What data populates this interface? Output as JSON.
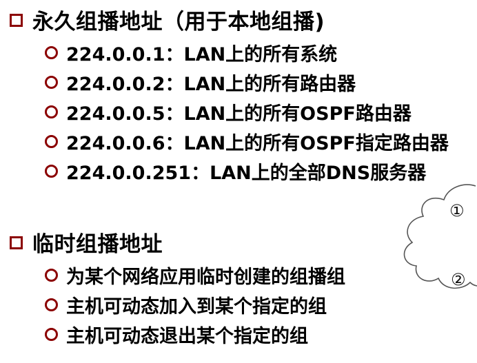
{
  "section1": {
    "title": "永久组播地址（用于本地组播)",
    "items": [
      "224.0.0.1：LAN上的所有系统",
      "224.0.0.2：LAN上的所有路由器",
      "224.0.0.5：LAN上的所有OSPF路由器",
      "224.0.0.6：LAN上的所有OSPF指定路由器",
      "224.0.0.251：LAN上的全部DNS服务器"
    ]
  },
  "section2": {
    "title": "临时组播地址",
    "items": [
      "为某个网络应用临时创建的组播组",
      "主机可动态加入到某个指定的组",
      "主机可动态退出某个指定的组"
    ]
  },
  "cloud": {
    "label_1": "①",
    "label_2": "②"
  },
  "colors": {
    "bullet": "#8b0000",
    "text": "#000000",
    "cloud_stroke": "#555555"
  }
}
